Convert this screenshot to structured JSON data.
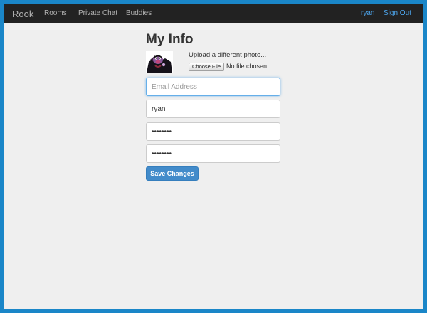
{
  "navbar": {
    "brand": "Rook",
    "links": [
      "Rooms",
      "Private Chat",
      "Buddies"
    ],
    "user": "ryan",
    "sign_out": "Sign Out"
  },
  "profile": {
    "title": "My Info",
    "upload_label": "Upload a different photo...",
    "file_button": "Choose File",
    "file_status": "No file chosen",
    "email_placeholder": "Email Address",
    "email_value": "",
    "username_value": "ryan",
    "password_value": "password",
    "password_confirm_value": "password",
    "save_button": "Save Changes"
  },
  "colors": {
    "page_border": "#1a86c8",
    "navbar_bg": "#222222",
    "link_accent": "#4da6ee",
    "primary_button": "#428bca"
  }
}
